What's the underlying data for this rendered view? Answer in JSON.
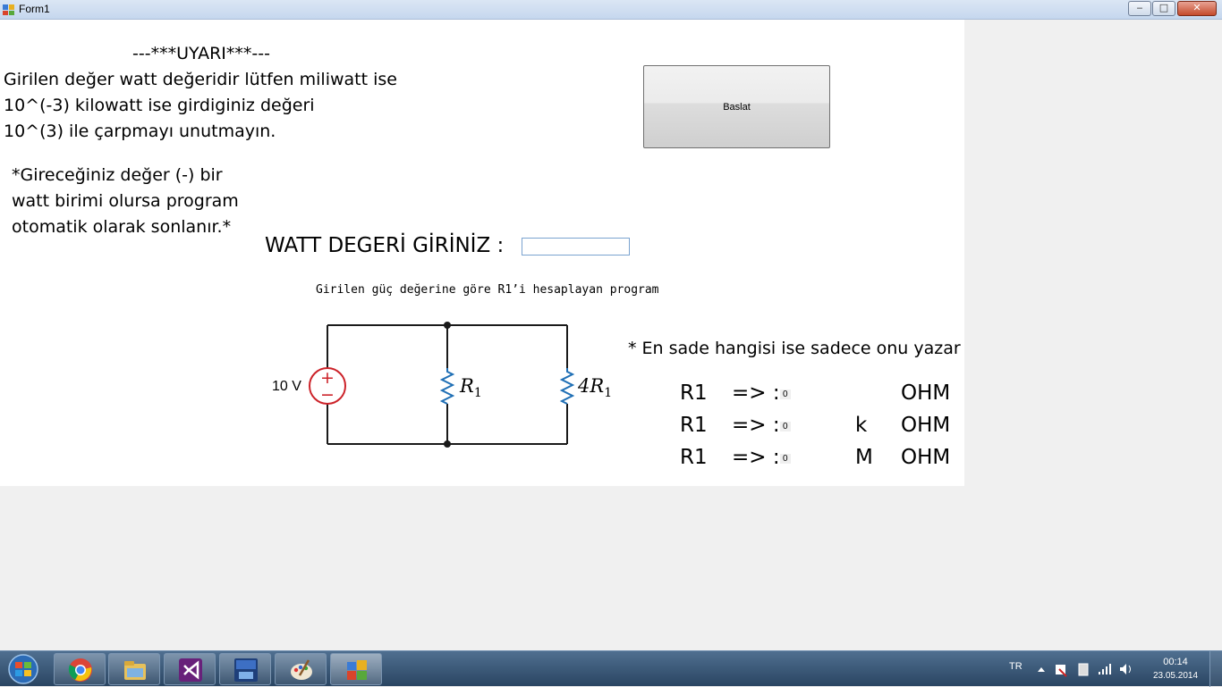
{
  "window": {
    "title": "Form1",
    "minimize_glyph": "‒",
    "maximize_glyph": "□",
    "close_glyph": "✕"
  },
  "form": {
    "warning_title": "---***UYARI***---",
    "warning_line1": "Girilen değer watt değeridir lütfen miliwatt ise",
    "warning_line2": "10^(-3)  kilowatt ise girdiginiz değeri",
    "warning_line3": "10^(3) ile çarpmayı unutmayın.",
    "note_line1": "*Gireceğiniz değer (-) bir",
    "note_line2": "watt birimi olursa program",
    "note_line3": "otomatik olarak sonlanır.*",
    "watt_label": "WATT DEGERİ GİRİNİZ :",
    "watt_input_value": "",
    "start_button_label": "Baslat",
    "circuit_caption": "Girilen güç değerine göre R1’i hesaplayan program",
    "hint_label": "* En sade hangisi ise sadece onu yazar"
  },
  "circuit": {
    "source_label": "10 V",
    "source_plus": "+",
    "source_minus": "−",
    "resistor1_label": "R",
    "resistor1_sub": "1",
    "resistor2_label": "4R",
    "resistor2_sub": "1",
    "wire_color": "#1a1a1a",
    "source_color": "#cc2229",
    "resistor_color": "#1f6fb5"
  },
  "results": [
    {
      "r_label": "R1",
      "arrow": "=>  :",
      "value": "0",
      "prefix": "",
      "unit": "OHM"
    },
    {
      "r_label": "R1",
      "arrow": "=>  :",
      "value": "0",
      "prefix": "k",
      "unit": "OHM"
    },
    {
      "r_label": "R1",
      "arrow": "=>  :",
      "value": "0",
      "prefix": "M",
      "unit": "OHM"
    }
  ],
  "taskbar": {
    "items": [
      "chrome-icon",
      "explorer-icon",
      "visual-studio-icon",
      "devcpp-icon",
      "paint-icon",
      "form-app-icon"
    ],
    "lang": "TR",
    "time": "00:14",
    "date": "23.05.2014"
  }
}
